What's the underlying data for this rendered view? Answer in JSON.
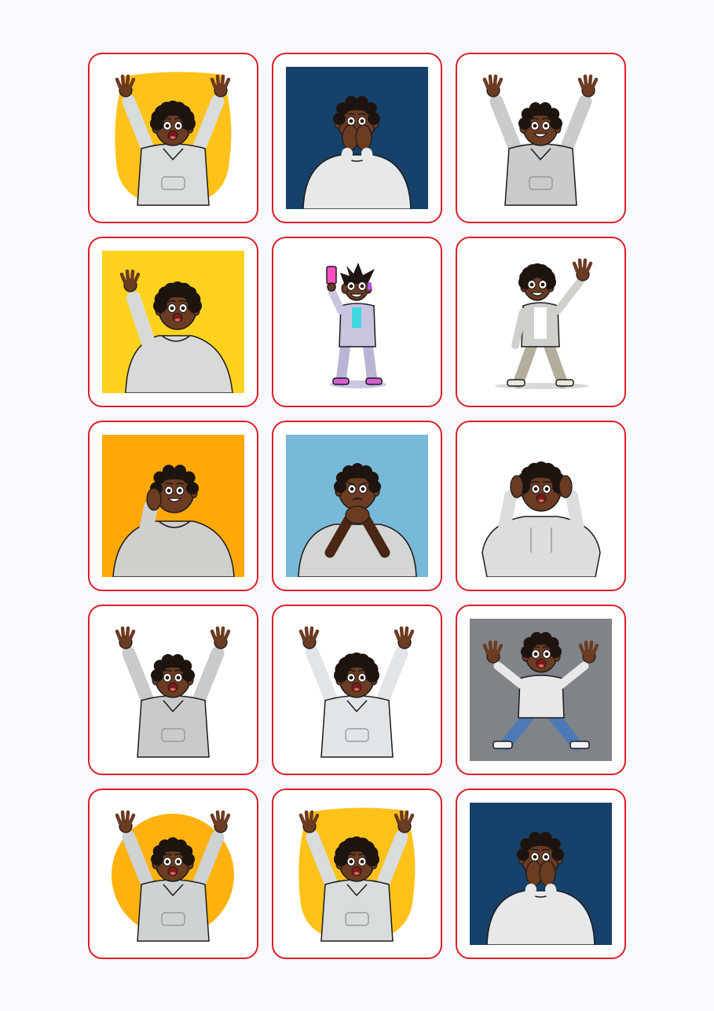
{
  "stickers": [
    {
      "icon": "boy-cheering-arms-up-yellow-blob-sticker",
      "bg": "#ffc21a",
      "bgShape": "blob",
      "pose": "arms-up",
      "mouth": "open",
      "top": "#d8dcdc",
      "hair": "curly"
    },
    {
      "icon": "boy-shocked-hands-over-mouth-navy-square-sticker",
      "bg": "#15416a",
      "bgShape": "square",
      "pose": "hands-mouth",
      "mouth": "hidden",
      "top": "#e6e8ea",
      "hair": "short"
    },
    {
      "icon": "boy-cheering-open-jacket-white-sticker",
      "bg": "#ffffff",
      "bgShape": "none",
      "pose": "arms-up",
      "mouth": "smile",
      "top": "#c9ccc8",
      "hair": "short"
    },
    {
      "icon": "boy-waving-hoodie-yellow-square-sticker",
      "bg": "#ffd21e",
      "bgShape": "square",
      "pose": "wave",
      "mouth": "open",
      "top": "#d7dad6",
      "hair": "curly"
    },
    {
      "icon": "boy-taking-selfie-pink-phone-sticker",
      "bg": "#ffffff",
      "bgShape": "none",
      "pose": "selfie",
      "mouth": "smile",
      "top": "#c9c5e0",
      "hair": "spiky"
    },
    {
      "icon": "boy-waving-full-body-white-sticker",
      "bg": "#ffffff",
      "bgShape": "none",
      "pose": "wave-full",
      "mouth": "smile",
      "top": "#cfd0cb",
      "hair": "curly"
    },
    {
      "icon": "boy-smiling-hand-on-cheek-orange-square-sticker",
      "bg": "#ffa808",
      "bgShape": "square",
      "pose": "hand-cheek",
      "mouth": "smile",
      "top": "#cfd0cc",
      "hair": "short"
    },
    {
      "icon": "boy-worried-hands-at-chin-blue-square-sticker",
      "bg": "#78b8d8",
      "bgShape": "square",
      "pose": "hands-chin",
      "mouth": "frown",
      "top": "#d4d6d4",
      "hair": "messy"
    },
    {
      "icon": "boy-shocked-hands-on-ears-white-sticker",
      "bg": "#ffffff",
      "bgShape": "none",
      "pose": "hands-ears",
      "mouth": "open",
      "top": "#dcdedd",
      "hair": "curly"
    },
    {
      "icon": "boy-surprised-arms-up-jacket-white-sticker",
      "bg": "#ffffff",
      "bgShape": "none",
      "pose": "arms-up",
      "mouth": "open",
      "top": "#c8cacb",
      "hair": "short"
    },
    {
      "icon": "boy-surprised-arms-up-shirt-white-sticker",
      "bg": "#ffffff",
      "bgShape": "none",
      "pose": "arms-up",
      "mouth": "open",
      "top": "#e2e5e8",
      "hair": "curly"
    },
    {
      "icon": "boy-jumping-excited-gray-square-sticker",
      "bg": "#808388",
      "bgShape": "square",
      "pose": "jump",
      "mouth": "open",
      "top": "#e8e8e8",
      "hair": "short"
    },
    {
      "icon": "boy-shouting-arms-up-orange-circle-sticker",
      "bg": "#ffb10f",
      "bgShape": "circle",
      "pose": "arms-up",
      "mouth": "open",
      "top": "#cfd2d3",
      "hair": "messy"
    },
    {
      "icon": "boy-cheering-arms-up-yellow-blob-sticker",
      "bg": "#ffc21a",
      "bgShape": "blob",
      "pose": "arms-up",
      "mouth": "open",
      "top": "#d8dcdc",
      "hair": "curly"
    },
    {
      "icon": "boy-shocked-hands-over-mouth-navy-square-sticker",
      "bg": "#15416a",
      "bgShape": "square",
      "pose": "hands-mouth",
      "mouth": "hidden",
      "top": "#e6e8ea",
      "hair": "short"
    }
  ]
}
